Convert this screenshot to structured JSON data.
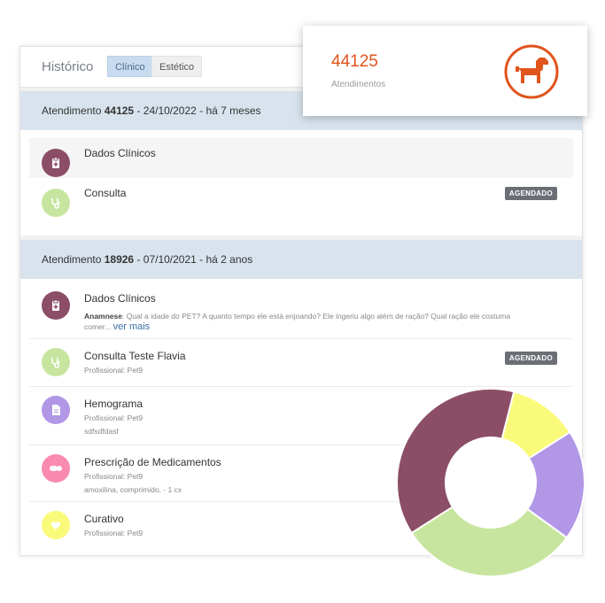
{
  "history": {
    "title": "Histórico",
    "tabs": [
      {
        "label": "Clínico",
        "active": true
      },
      {
        "label": "Estético",
        "active": false
      }
    ]
  },
  "attendances": [
    {
      "label": "Atendimento",
      "number": "44125",
      "date_text": " - 24/10/2022 - há 7 meses",
      "items": [
        {
          "title": "Dados Clínicos",
          "icon": "clipboard-icon",
          "color": "#8b4e66"
        },
        {
          "title": "Consulta",
          "icon": "stethoscope-icon",
          "color": "#c7e59e",
          "badge": "AGENDADO"
        }
      ]
    },
    {
      "label": "Atendimento",
      "number": "18926",
      "date_text": " - 07/10/2021 - há 2 anos",
      "items": [
        {
          "title": "Dados Clínicos",
          "icon": "clipboard-icon",
          "color": "#8b4e66",
          "anamnese_label": "Anamnese",
          "anamnese_text": ": Qual a idade do PET? A quanto tempo ele está enjoando? Ele ingeriu algo além de ração? Qual ração ele costuma",
          "anamnese_cont": "comer...",
          "more_link": "ver mais"
        },
        {
          "title": "Consulta Teste Flavia",
          "icon": "stethoscope-icon",
          "color": "#c7e59e",
          "professional": "Profissional: Pet9",
          "badge": "AGENDADO"
        },
        {
          "title": "Hemograma",
          "icon": "document-icon",
          "color": "#b197e6",
          "professional": "Profissional: Pet9",
          "note": "sdfsdfdasf"
        },
        {
          "title": "Prescrição de Medicamentos",
          "icon": "pills-icon",
          "color": "#f98ab0",
          "professional": "Profissional: Pet9",
          "note": "amoxilina, comprimido, - 1 cx"
        },
        {
          "title": "Curativo",
          "icon": "heart-icon",
          "color": "#fafa7a",
          "professional": "Profissional: Pet9"
        }
      ]
    }
  ],
  "stat": {
    "value": "44125",
    "label": "Atendimentos",
    "icon": "dog-icon",
    "accent": "#e0541c"
  },
  "chart_data": {
    "type": "pie",
    "style": "donut",
    "values": [
      12,
      19,
      31,
      38
    ],
    "colors": [
      "#fafa7a",
      "#b197e6",
      "#c7e59e",
      "#8b4e66"
    ]
  }
}
